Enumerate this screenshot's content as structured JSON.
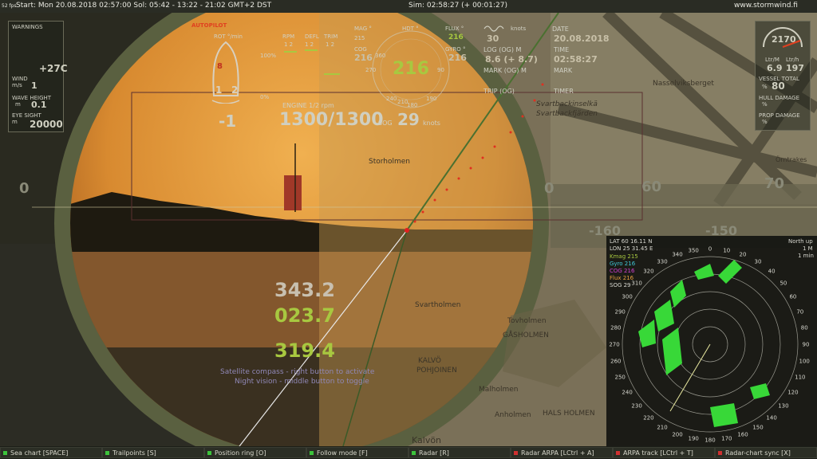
{
  "topbar": {
    "fps": "52 fps",
    "start": "Start: Mon 20.08.2018  02:57:00  Sol: 05:42 - 13:22 - 21:02  GMT+2  DST",
    "sim": "Sim: 02:58:27 (+ 00:01:27)",
    "site": "www.stormwind.fi"
  },
  "warnings": {
    "title": "WARNINGS",
    "wind_label": "WIND",
    "wind_unit": "m/s",
    "wind_value": "1",
    "temp": "+27C",
    "wave_label": "WAVE HEIGHT",
    "wave_unit": "m",
    "wave_value": "0.1",
    "eye_label": "EYE SIGHT",
    "eye_unit": "m",
    "eye_value": "20000"
  },
  "autopilot": {
    "title": "AUTOPILOT",
    "rot_label": "ROT °/min",
    "rot_value": "-1",
    "engine_ids": [
      "1",
      "2"
    ],
    "engine_marker": "8"
  },
  "engine": {
    "rpm_label": "RPM",
    "defl_label": "DEFL",
    "trim_label": "TRIM",
    "one_two": "1  2",
    "pct100": "100%",
    "pct0": "0%",
    "engine_label": "ENGINE 1/2 rpm",
    "rpm_value": "1300/1300",
    "sog_label": "SOG",
    "sog_value": "29",
    "sog_unit": "knots"
  },
  "compass": {
    "mag_label": "MAG °",
    "hdt_label": "HDT °",
    "flux_label": "FLUX °",
    "flux_value": "216",
    "cog_label": "COG",
    "cog_value": "216",
    "gyro_label": "GYRO °",
    "gyro_value": "216",
    "heading_value": "216",
    "mag_value": "215",
    "ticks": [
      "360",
      "270",
      "90",
      "180",
      "240",
      "210",
      "190"
    ]
  },
  "log": {
    "knots_value": "30",
    "knots_label": "knots",
    "log_label": "LOG (OG) M",
    "log_value": "8.6 (+ 8.7)",
    "mark_label": "MARK (OG) M",
    "trip_label": "TRIP (OG)",
    "date_label": "DATE",
    "date_value": "20.08.2018",
    "time_label": "TIME",
    "time_value": "02:58:27",
    "mark2_label": "MARK",
    "timer_label": "TIMER"
  },
  "vessel": {
    "rpm_gauge": "2170",
    "fuel_l_label": "Ltr/M",
    "fuel_h_label": "Ltr/h",
    "fuel_l": "6.9",
    "fuel_h": "197",
    "vessel_total": "VESSEL TOTAL",
    "vessel_total_unit": "%",
    "vessel_total_value": "80",
    "hull_label": "HULL DAMAGE",
    "hull_unit": "%",
    "prop_label": "PROP DAMAGE",
    "prop_unit": "%"
  },
  "scope": {
    "bearing1": "343.2",
    "bearing2": "023.7",
    "bearing3": "319.4",
    "hint1": "Satellite compass - right button to activate",
    "hint2": "Night vision - middle button to toggle"
  },
  "hud_scale": {
    "left_zero": "0",
    "right_zero": "0",
    "mark60": "60",
    "mark70": "70",
    "mark_m160": "-160",
    "mark_m150": "-150"
  },
  "map_labels": [
    "Storholmen",
    "Svartbackinselkä",
    "Svartbackfjärden",
    "Nasselviksberget",
    "Svartholmen",
    "Tovholmen",
    "GÅSHOLMEN",
    "KALVÖ",
    "POHJOINEN",
    "Anholmen",
    "HALS HOLMEN",
    "Kalvön",
    "Örntrakes",
    "Malholmen"
  ],
  "radar": {
    "lat": "LAT 60 16.11 N",
    "lon": "LON 25 31.45 E",
    "kmag": "Kmag  215",
    "gyro": "Gyro  216",
    "cog": "COG  216",
    "flux": "Flux  216",
    "sog": "SOG  29",
    "mode": "North up",
    "range": "1 M",
    "interval": "1 min",
    "bearings": [
      "350",
      "0",
      "10",
      "20",
      "30",
      "40",
      "50",
      "60",
      "70",
      "80",
      "90",
      "100",
      "110",
      "120",
      "130",
      "140",
      "150",
      "160",
      "170",
      "180",
      "190",
      "200",
      "210",
      "220",
      "230",
      "240",
      "250",
      "260",
      "270",
      "280",
      "290",
      "300",
      "310",
      "320",
      "330",
      "340"
    ]
  },
  "bottombar": {
    "buttons": [
      {
        "label": "Sea chart [SPACE]",
        "dot": "#3cc43c"
      },
      {
        "label": "Trailpoints [S]",
        "dot": "#3cc43c"
      },
      {
        "label": "Position ring [O]",
        "dot": "#3cc43c"
      },
      {
        "label": "Follow mode [F]",
        "dot": "#3cc43c"
      },
      {
        "label": "Radar [R]",
        "dot": "#3cc43c"
      },
      {
        "label": "Radar ARPA [LCtrl + A]",
        "dot": "#d03030"
      },
      {
        "label": "ARPA track [LCtrl + T]",
        "dot": "#d03030"
      },
      {
        "label": "Radar-chart sync [X]",
        "dot": "#d03030"
      }
    ]
  },
  "colors": {
    "accent_green": "#a8c840",
    "scope_orange": "#e8a040",
    "radar_echo": "#38d838",
    "warn_red": "#e04020"
  }
}
